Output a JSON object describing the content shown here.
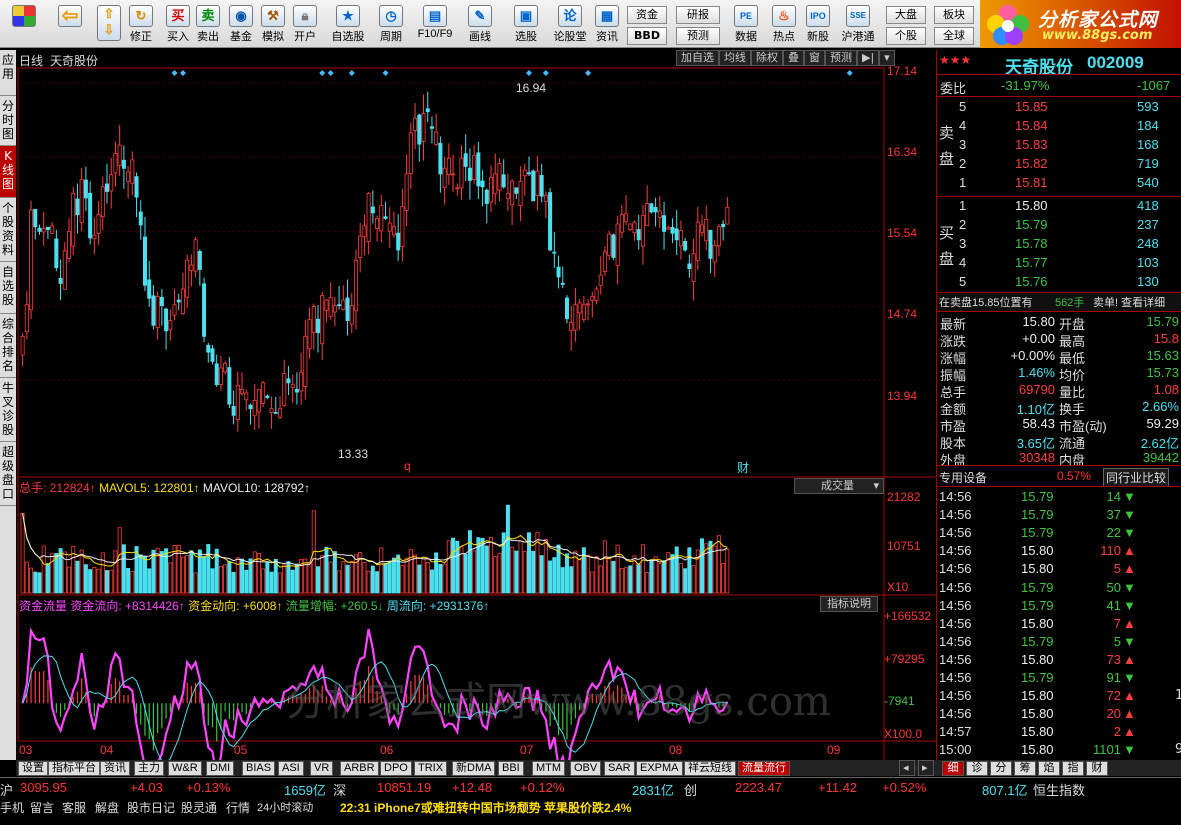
{
  "toolbar": {
    "buttons": [
      "",
      "",
      "修正",
      "买入",
      "卖出",
      "基金",
      "模拟",
      "开户",
      "自选股",
      "周期",
      "F10/F9",
      "画线",
      "选股",
      "论股堂",
      "资讯",
      "",
      "",
      "数据",
      "热点",
      "新股",
      "沪港通",
      "",
      ""
    ],
    "glyphs": [
      "",
      "",
      "",
      "买",
      "卖",
      "",
      "",
      "",
      "",
      "",
      "",
      "",
      "",
      "论",
      "",
      "",
      "",
      "",
      "",
      "",
      "",
      "",
      ""
    ],
    "small": {
      "zijin": "资金",
      "bbd": "BBD",
      "yanbao": "研报",
      "yuce": "预测",
      "dapan": "大盘",
      "gegu": "个股",
      "bankuai": "板块",
      "quanqiu": "全球"
    },
    "logo_title": "分析家公式网",
    "logo_url": "www.88gs.com"
  },
  "colors": {
    "up": "#ff3c3c",
    "down": "#4ae0f0",
    "accent": "#ffde00",
    "panel_border": "#aa0000"
  },
  "leftbar": [
    "应用",
    "分时图",
    "K线图",
    "个股资料",
    "自选股",
    "综合排名",
    "牛叉诊股",
    "超级盘口"
  ],
  "chart": {
    "period_label": "日线",
    "stock_name": "天奇股份",
    "top_buttons": [
      "加自选",
      "均线",
      "除权",
      "叠",
      "窗",
      "预测"
    ],
    "high_mark": "16.94",
    "low_mark": "13.33",
    "marker_q": "q",
    "marker_cai": "财",
    "price_axis": [
      "17.14",
      "16.34",
      "15.54",
      "14.74",
      "13.94"
    ],
    "volume_header": {
      "total": "总手: 212824↑",
      "ma5": "MAVOL5: 122801↑",
      "ma10": "MAVOL10: 128792↑"
    },
    "volume_dropdown": "成交量",
    "volume_axis": [
      "21282",
      "10751",
      "X10"
    ],
    "flow_header": {
      "name": "资金流量",
      "a": "资金流向: +8314426↑",
      "b": "资金动向: +6008↑",
      "c": "流量增幅: +260.5↓",
      "d": "周流向: +2931376↑"
    },
    "flow_button": "指标说明",
    "flow_axis": [
      "+166532",
      "+79295",
      "-7941",
      "X100.0"
    ],
    "months": [
      "03",
      "04",
      "05",
      "06",
      "07",
      "08",
      "09"
    ],
    "watermark": "分析家公式网www.88gs.com"
  },
  "chart_data": {
    "type": "candlestick",
    "title": "天奇股份 日线",
    "ylim": [
      13.1,
      17.3
    ],
    "x": [
      1,
      2,
      3,
      4,
      5,
      6,
      7,
      8,
      9,
      10,
      11,
      12,
      13,
      14,
      15,
      16,
      17,
      18,
      19,
      20,
      21,
      22,
      23,
      24,
      25,
      26,
      27,
      28,
      29,
      30,
      31,
      32,
      33,
      34,
      35,
      36,
      37,
      38,
      39,
      40,
      41,
      42,
      43,
      44,
      45,
      46,
      47,
      48,
      49,
      50,
      51,
      52,
      53,
      54,
      55,
      56,
      57,
      58,
      59,
      60,
      61,
      62,
      63,
      64,
      65,
      66,
      67,
      68,
      69,
      70,
      71,
      72,
      73,
      74,
      75,
      76,
      77,
      78,
      79,
      80,
      81,
      82,
      83,
      84,
      85,
      86,
      87,
      88,
      89,
      90,
      91,
      92,
      93,
      94,
      95,
      96,
      97,
      98,
      99,
      100,
      101,
      102,
      103,
      104,
      105,
      106,
      107,
      108,
      109,
      110,
      111,
      112,
      113,
      114,
      115,
      116,
      117,
      118,
      119,
      120,
      121,
      122,
      123,
      124,
      125,
      126,
      127,
      128,
      129,
      130,
      131,
      132,
      133,
      134,
      135,
      136,
      137,
      138,
      139,
      140,
      141,
      142,
      143,
      144,
      145,
      146,
      147,
      148,
      149,
      150,
      151,
      152,
      153,
      154,
      155,
      156,
      157,
      158,
      159,
      160,
      161,
      162,
      163,
      164,
      165,
      166,
      167,
      168,
      169,
      170,
      171,
      172,
      173,
      174,
      175,
      176,
      177,
      178,
      179,
      180,
      181,
      182,
      183,
      184,
      185,
      186,
      187,
      188,
      189,
      190,
      191,
      192,
      193,
      194,
      195,
      196,
      197,
      198,
      199,
      200,
      201,
      202,
      203
    ],
    "close": [
      14.41,
      14.75,
      15.77,
      15.59,
      15.54,
      15.57,
      15.56,
      15.6,
      15.15,
      14.98,
      15.33,
      15.54,
      15.95,
      15.72,
      16.1,
      15.9,
      15.47,
      15.5,
      15.72,
      16.02,
      15.97,
      16.15,
      16.38,
      16.47,
      16.22,
      16.18,
      16.31,
      15.91,
      15.61,
      14.96,
      14.82,
      14.53,
      14.84,
      14.74,
      14.47,
      14.58,
      14.75,
      14.78,
      14.92,
      15.23,
      15.18,
      15.45,
      15.13,
      14.41,
      14.24,
      14.14,
      13.89,
      14.07,
      14.12,
      13.68,
      13.56,
      13.88,
      13.84,
      13.8,
      13.63,
      13.72,
      13.84,
      13.91,
      13.75,
      13.63,
      13.59,
      13.63,
      14.01,
      13.91,
      13.89,
      13.81,
      14.02,
      14.41,
      14.59,
      14.73,
      14.45,
      14.85,
      14.8,
      14.83,
      14.74,
      14.74,
      14.8,
      14.58,
      14.74,
      15.23,
      15.49,
      15.6,
      15.95,
      15.74,
      15.68,
      15.82,
      15.68,
      15.63,
      15.59,
      15.34,
      15.81,
      16.16,
      16.6,
      16.76,
      16.48,
      16.81,
      16.83,
      16.65,
      16.61,
      16.16,
      16.22,
      16.33,
      16.16,
      16.01,
      16.33,
      16.24,
      16.09,
      16.36,
      16.03,
      16.02,
      15.84,
      16.12,
      16.16,
      16.27,
      16.02,
      15.95,
      16.08,
      15.95,
      16.08,
      16.2,
      16.16,
      15.87,
      16.19,
      15.92,
      15.93,
      15.34,
      15.31,
      15.05,
      14.97,
      14.6,
      14.56,
      14.75,
      14.77,
      14.75,
      14.76,
      14.84,
      14.92,
      15.07,
      15.32,
      15.51,
      15.26,
      15.62,
      15.72,
      15.73,
      15.62,
      15.64,
      15.45,
      15.71,
      15.84,
      15.75,
      15.75,
      15.76,
      15.54,
      15.58,
      15.52,
      15.45,
      15.55,
      15.34,
      15.14,
      15.3,
      15.64,
      15.61,
      15.67,
      15.25,
      15.39,
      15.59,
      15.59,
      15.8
    ],
    "volume_unit": "手",
    "volume_ylim": [
      0,
      21282
    ],
    "flow_ylim": [
      -60000,
      166532
    ],
    "months": [
      "03",
      "04",
      "05",
      "06",
      "07",
      "08",
      "09"
    ]
  },
  "panel": {
    "stock_name": "天奇股份",
    "stock_code": "002009",
    "stars": "★★★",
    "weibi_label": "委比",
    "weibi_pct": "-31.97%",
    "weibi_diff": "-1067",
    "sell_label": [
      "卖",
      "盘"
    ],
    "buy_label": [
      "买",
      "盘"
    ],
    "sell": [
      {
        "lvl": "5",
        "price": "15.85",
        "vol": "593"
      },
      {
        "lvl": "4",
        "price": "15.84",
        "vol": "184"
      },
      {
        "lvl": "3",
        "price": "15.83",
        "vol": "168"
      },
      {
        "lvl": "2",
        "price": "15.82",
        "vol": "719"
      },
      {
        "lvl": "1",
        "price": "15.81",
        "vol": "540"
      }
    ],
    "buy": [
      {
        "lvl": "1",
        "price": "15.80",
        "vol": "418"
      },
      {
        "lvl": "2",
        "price": "15.79",
        "vol": "237"
      },
      {
        "lvl": "3",
        "price": "15.78",
        "vol": "248"
      },
      {
        "lvl": "4",
        "price": "15.77",
        "vol": "103"
      },
      {
        "lvl": "5",
        "price": "15.76",
        "vol": "130"
      }
    ],
    "notice_left": "在卖盘15.85位置有",
    "notice_vol": "562手",
    "notice_right": "卖单! 查看详细",
    "stats_left": [
      {
        "k": "最新",
        "v": "15.80"
      },
      {
        "k": "涨跌",
        "v": "+0.00"
      },
      {
        "k": "涨幅",
        "v": "+0.00%"
      },
      {
        "k": "振幅",
        "v": "1.46%"
      },
      {
        "k": "总手",
        "v": "69790"
      },
      {
        "k": "金额",
        "v": "1.10亿"
      },
      {
        "k": "市盈",
        "v": "58.43"
      },
      {
        "k": "股本",
        "v": "3.65亿"
      },
      {
        "k": "外盘",
        "v": "30348"
      }
    ],
    "stats_right": [
      {
        "k": "开盘",
        "v": "15.79"
      },
      {
        "k": "最高",
        "v": "15.8"
      },
      {
        "k": "最低",
        "v": "15.63"
      },
      {
        "k": "均价",
        "v": "15.73"
      },
      {
        "k": "量比",
        "v": "1.08"
      },
      {
        "k": "换手",
        "v": "2.66%"
      },
      {
        "k": "市盈(动)",
        "v": "59.29"
      },
      {
        "k": "流通",
        "v": "2.62亿"
      },
      {
        "k": "内盘",
        "v": "39442"
      }
    ],
    "sector_name": "专用设备",
    "sector_pct": "0.57%",
    "sector_btn": "同行业比较",
    "ticks": [
      {
        "t": "14:56",
        "p": "15.79",
        "v": "14",
        "d": "down"
      },
      {
        "t": "14:56",
        "p": "15.79",
        "v": "37",
        "d": "down"
      },
      {
        "t": "14:56",
        "p": "15.79",
        "v": "22",
        "d": "down"
      },
      {
        "t": "14:56",
        "p": "15.80",
        "v": "110",
        "d": "up"
      },
      {
        "t": "14:56",
        "p": "15.80",
        "v": "5",
        "d": "up"
      },
      {
        "t": "14:56",
        "p": "15.79",
        "v": "50",
        "d": "down"
      },
      {
        "t": "14:56",
        "p": "15.79",
        "v": "41",
        "d": "down"
      },
      {
        "t": "14:56",
        "p": "15.80",
        "v": "7",
        "d": "up"
      },
      {
        "t": "14:56",
        "p": "15.79",
        "v": "5",
        "d": "down"
      },
      {
        "t": "14:56",
        "p": "15.80",
        "v": "73",
        "d": "up"
      },
      {
        "t": "14:56",
        "p": "15.79",
        "v": "91",
        "d": "down"
      },
      {
        "t": "14:56",
        "p": "15.80",
        "v": "72",
        "d": "up"
      },
      {
        "t": "14:56",
        "p": "15.80",
        "v": "20",
        "d": "up"
      },
      {
        "t": "14:57",
        "p": "15.80",
        "v": "2",
        "d": "up"
      },
      {
        "t": "15:00",
        "p": "15.80",
        "v": "1101",
        "d": "down"
      }
    ],
    "tick_extra_1": "1",
    "tick_extra_2": "9",
    "sub_tabs": [
      "细",
      "诊",
      "分",
      "筹",
      "焰",
      "指",
      "财"
    ]
  },
  "indicator_tabs": [
    "设置",
    "指标平台",
    "资讯",
    "主力",
    "W&R",
    "DMI",
    "BIAS",
    "ASI",
    "VR",
    "ARBR",
    "DPO",
    "TRIX",
    "新DMA",
    "BBI",
    "MTM",
    "OBV",
    "SAR",
    "EXPMA",
    "祥云短线",
    "流量流行"
  ],
  "status": {
    "sh_label": "沪",
    "sh_index": "3095.95",
    "sh_chg": "+4.03",
    "sh_pct": "+0.13%",
    "sh_amt": "1659亿",
    "sz_label": "深",
    "sz_index": "10851.19",
    "sz_chg": "+12.48",
    "sz_pct": "+0.12%",
    "sz_amt": "2831亿",
    "cy_label": "创",
    "cy_index": "2223.47",
    "cy_chg": "+11.42",
    "cy_pct": "+0.52%",
    "cy_amt": "807.1亿",
    "hs_label": "恒生指数",
    "links": [
      "手机",
      "留言",
      "客服",
      "解盘",
      "股市日记",
      "股灵通",
      "行情",
      "24小时滚动"
    ],
    "news": "22:31 iPhone7或难扭转中国市场颓势 苹果股价跌2.4%"
  }
}
